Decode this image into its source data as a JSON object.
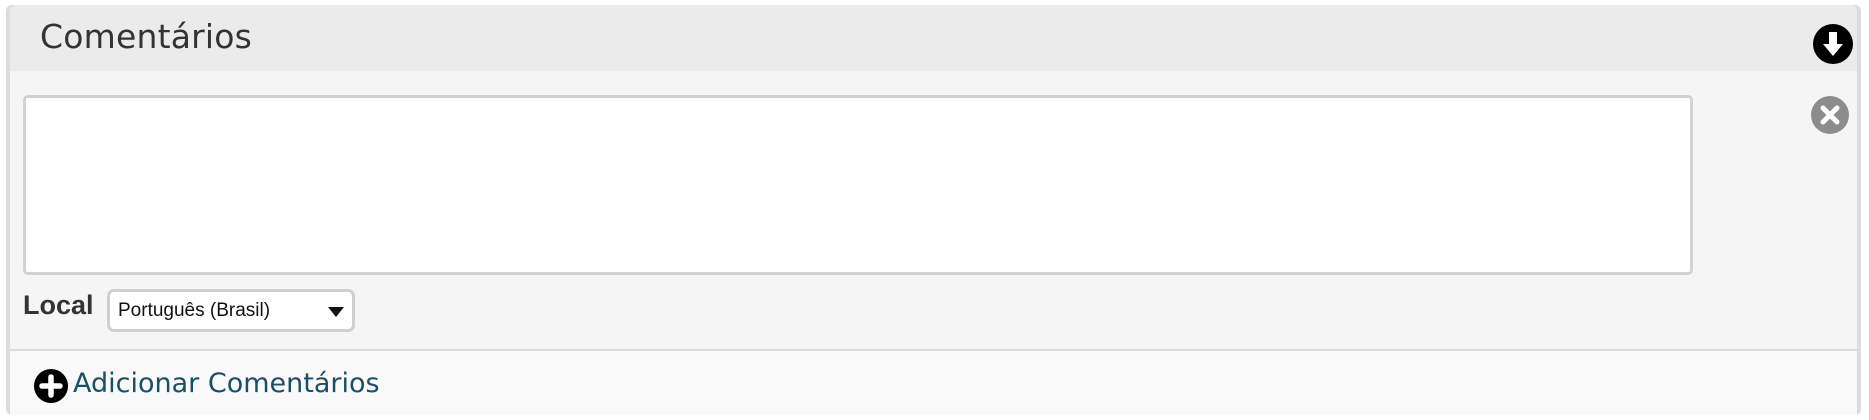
{
  "panel": {
    "title": "Comentários",
    "collapse_icon": "arrow-down-circle-icon",
    "remove_icon": "close-circle-icon"
  },
  "comment": {
    "value": "",
    "placeholder": ""
  },
  "locale": {
    "label": "Local",
    "selected": "Português (Brasil)",
    "caret_icon": "caret-down-icon"
  },
  "footer": {
    "add_label": "Adicionar Comentários",
    "add_icon": "plus-circle-icon"
  },
  "colors": {
    "header_bg": "#ebebeb",
    "body_bg": "#f5f5f5",
    "link": "#1b4f63",
    "remove_icon": "#8c8c8c"
  }
}
